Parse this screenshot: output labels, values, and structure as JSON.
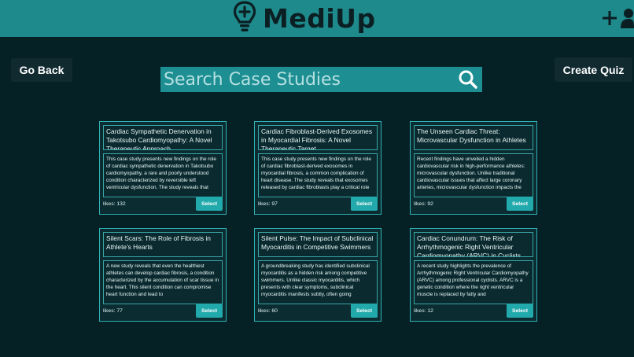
{
  "header": {
    "brand": "MediUp",
    "add_icon": "plus-icon",
    "user_icon": "user-icon",
    "logo_icon": "lightbulb-plus-icon"
  },
  "nav": {
    "back_label": "Go Back",
    "create_quiz_label": "Create Quiz"
  },
  "search": {
    "placeholder": "Search Case Studies",
    "icon": "search-icon"
  },
  "cards": [
    {
      "title": "Cardiac Sympathetic Denervation in Takotsubo Cardiomyopathy: A Novel Therapeutic Approach",
      "description": "This case study presents new findings on the role of cardiac sympathetic denervation in Takotsubo cardiomyopathy, a rare and poorly understood condition characterized by reversible left ventricular dysfunction. The study reveals that",
      "likes": "likes: 132",
      "select_label": "Select"
    },
    {
      "title": "Cardiac Fibroblast-Derived Exosomes in Myocardial Fibrosis: A Novel Therapeutic Target",
      "description": "This case study presents new findings on the role of cardiac fibroblast-derived exosomes in myocardial fibrosis, a common complication of heart disease. The study reveals that exosomes released by cardiac fibroblasts play a critical role",
      "likes": "likes: 97",
      "select_label": "Select"
    },
    {
      "title": "The Unseen Cardiac Threat: Microvascular Dysfunction in Athletes",
      "description": "Recent findings have unveiled a hidden cardiovascular risk in high-performance athletes: microvascular dysfunction. Unlike traditional cardiovascular issues that affect large coronary arteries, microvascular dysfunction impacts the",
      "likes": "likes: 92",
      "select_label": "Select"
    },
    {
      "title": "Silent Scars: The Role of Fibrosis in Athlete's Hearts",
      "description": "A new study reveals that even the healthiest athletes can develop cardiac fibrosis, a condition characterized by the accumulation of scar tissue in the heart. This silent condition can compromise heart function and lead to",
      "likes": "likes: 77",
      "select_label": "Select"
    },
    {
      "title": "Silent Pulse: The Impact of Subclinical Myocarditis in Competitive Swimmers",
      "description": "A groundbreaking study has identified subclinical myocarditis as a hidden risk among competitive swimmers. Unlike classic myocarditis, which presents with clear symptoms, subclinical myocarditis manifests subtly, often going",
      "likes": "likes: 60",
      "select_label": "Select"
    },
    {
      "title": "Cardiac Conundrum: The Risk of Arrhythmogenic Right Ventricular Cardiomyopathy (ARVC) in Cyclists",
      "description": "A recent study highlights the prevalence of Arrhythmogenic Right Ventricular Cardiomyopathy (ARVC) among professional cyclists. ARVC is a genetic condition where the right ventricular muscle is replaced by fatty and",
      "likes": "likes: 12",
      "select_label": "Select"
    }
  ],
  "colors": {
    "background": "#062126",
    "header": "#1f8a8c",
    "accent": "#22a9ab",
    "dark_button": "#102a30"
  }
}
